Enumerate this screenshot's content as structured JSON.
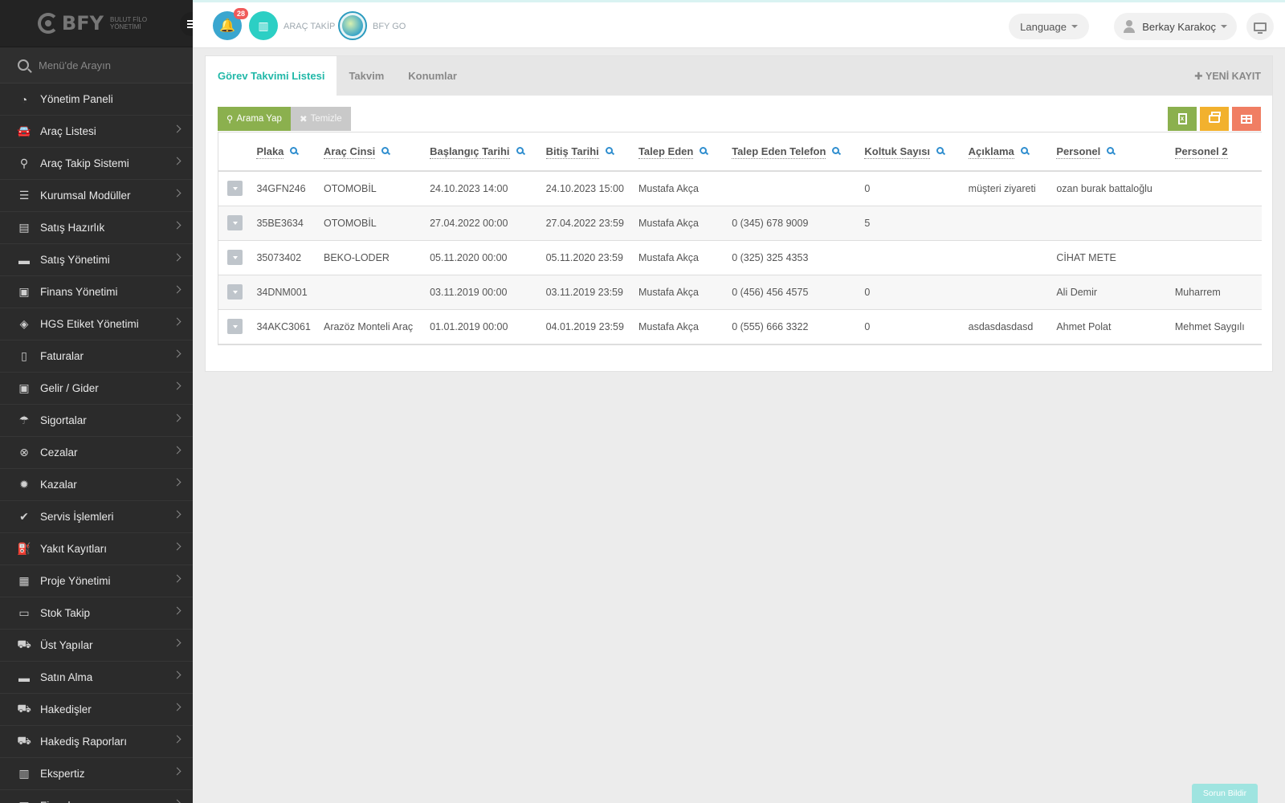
{
  "brand": {
    "name": "BFY",
    "sub_line1": "BULUT FİLO",
    "sub_line2": "YÖNETİMİ"
  },
  "sidebar": {
    "search_placeholder": "Menü'de Arayın",
    "items": [
      {
        "label": "Yönetim Paneli",
        "icon": "dashboard-icon",
        "glyph": "◔",
        "chevron": false
      },
      {
        "label": "Araç Listesi",
        "icon": "car-icon",
        "glyph": "🚘",
        "chevron": true
      },
      {
        "label": "Araç Takip Sistemi",
        "icon": "map-marker-icon",
        "glyph": "⚲",
        "chevron": true
      },
      {
        "label": "Kurumsal Modüller",
        "icon": "server-icon",
        "glyph": "☰",
        "chevron": true
      },
      {
        "label": "Satış Hazırlık",
        "icon": "book-icon",
        "glyph": "▤",
        "chevron": true
      },
      {
        "label": "Satış Yönetimi",
        "icon": "credit-card-icon",
        "glyph": "▬",
        "chevron": true
      },
      {
        "label": "Finans Yönetimi",
        "icon": "money-icon",
        "glyph": "▣",
        "chevron": true
      },
      {
        "label": "HGS Etiket Yönetimi",
        "icon": "tags-icon",
        "glyph": "◈",
        "chevron": true
      },
      {
        "label": "Faturalar",
        "icon": "file-icon",
        "glyph": "▯",
        "chevron": true
      },
      {
        "label": "Gelir / Gider",
        "icon": "cash-icon",
        "glyph": "▣",
        "chevron": true
      },
      {
        "label": "Sigortalar",
        "icon": "umbrella-icon",
        "glyph": "☂",
        "chevron": true
      },
      {
        "label": "Cezalar",
        "icon": "times-circle-icon",
        "glyph": "⊗",
        "chevron": true
      },
      {
        "label": "Kazalar",
        "icon": "car-crash-icon",
        "glyph": "✹",
        "chevron": true
      },
      {
        "label": "Servis İşlemleri",
        "icon": "check-circle-icon",
        "glyph": "✔",
        "chevron": true
      },
      {
        "label": "Yakıt Kayıtları",
        "icon": "gas-pump-icon",
        "glyph": "⛽",
        "chevron": true
      },
      {
        "label": "Proje Yönetimi",
        "icon": "briefcase-icon",
        "glyph": "▦",
        "chevron": true
      },
      {
        "label": "Stok Takip",
        "icon": "inbox-icon",
        "glyph": "▭",
        "chevron": true
      },
      {
        "label": "Üst Yapılar",
        "icon": "truck-icon",
        "glyph": "⛟",
        "chevron": true
      },
      {
        "label": "Satın Alma",
        "icon": "credit-card-icon",
        "glyph": "▬",
        "chevron": true
      },
      {
        "label": "Hakedişler",
        "icon": "truck-icon",
        "glyph": "⛟",
        "chevron": true
      },
      {
        "label": "Hakediş Raporları",
        "icon": "truck-icon",
        "glyph": "⛟",
        "chevron": true
      },
      {
        "label": "Ekspertiz",
        "icon": "newspaper-icon",
        "glyph": "▥",
        "chevron": true
      },
      {
        "label": "Firmalar",
        "icon": "building-icon",
        "glyph": "▦",
        "chevron": true
      }
    ]
  },
  "topbar": {
    "notification_count": "28",
    "arac_takip_label": "ARAÇ TAKİP",
    "bfy_go_label": "BFY GO",
    "language_label": "Language",
    "user_name": "Berkay Karakoç"
  },
  "tabs": [
    {
      "label": "Görev Takvimi Listesi",
      "active": true
    },
    {
      "label": "Takvim",
      "active": false
    },
    {
      "label": "Konumlar",
      "active": false
    }
  ],
  "new_record_label": "✚ YENİ KAYIT",
  "toolbar": {
    "search_label": "Arama Yap",
    "clear_label": "Temizle"
  },
  "table": {
    "columns": [
      "",
      "Plaka",
      "Araç Cinsi",
      "Başlangıç Tarihi",
      "Bitiş Tarihi",
      "Talep Eden",
      "Talep Eden Telefon",
      "Koltuk Sayısı",
      "Açıklama",
      "Personel",
      "Personel 2"
    ],
    "rows": [
      [
        "",
        "34GFN246",
        "OTOMOBİL",
        "24.10.2023 14:00",
        "24.10.2023 15:00",
        "Mustafa Akça",
        "",
        "0",
        "müşteri ziyareti",
        "ozan burak battaloğlu",
        ""
      ],
      [
        "",
        "35BE3634",
        "OTOMOBİL",
        "27.04.2022 00:00",
        "27.04.2022 23:59",
        "Mustafa Akça",
        "0 (345) 678 9009",
        "5",
        "",
        "",
        ""
      ],
      [
        "",
        "35073402",
        "BEKO-LODER",
        "05.11.2020 00:00",
        "05.11.2020 23:59",
        "Mustafa Akça",
        "0 (325) 325 4353",
        "",
        "",
        "CİHAT METE",
        ""
      ],
      [
        "",
        "34DNM001",
        "",
        "03.11.2019 00:00",
        "03.11.2019 23:59",
        "Mustafa Akça",
        "0 (456) 456 4575",
        "0",
        "",
        "Ali Demir",
        "Muharrem"
      ],
      [
        "",
        "34AKC3061",
        "Arazöz Monteli Araç",
        "01.01.2019 00:00",
        "04.01.2019 23:59",
        "Mustafa Akça",
        "0 (555) 666 3322",
        "0",
        "asdasdasdasd",
        "Ahmet Polat",
        "Mehmet Saygılı"
      ]
    ]
  },
  "report_button_label": "Sorun Bildir"
}
